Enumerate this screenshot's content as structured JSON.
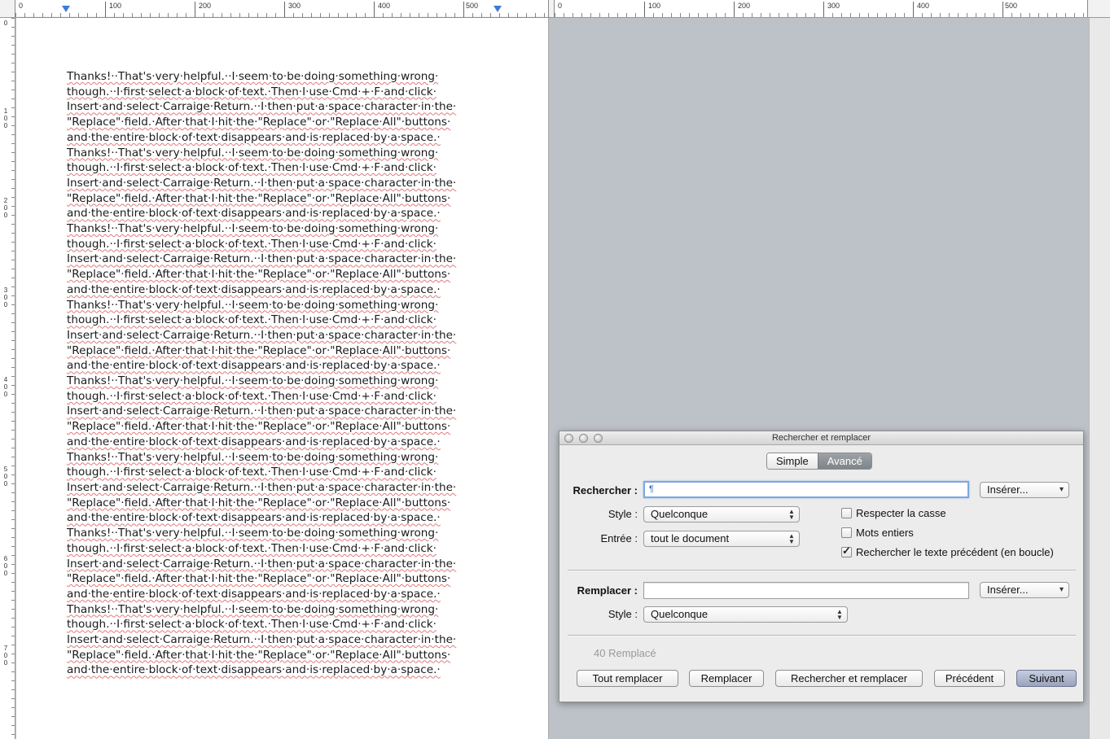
{
  "ruler": {
    "left_labels": [
      "0",
      "100",
      "200",
      "300",
      "400",
      "500"
    ],
    "right_labels": [
      "0",
      "100",
      "200",
      "300",
      "400",
      "500"
    ],
    "side_labels": [
      "0",
      "1 0 0",
      "2 0 0",
      "3 0 0",
      "4 0 0",
      "5 0 0",
      "6 0 0",
      "7 0 0"
    ]
  },
  "document": {
    "lines": [
      "Thanks!··That's·very·helpful.··I·seem·to·be·doing·something·wrong·",
      "though.··I·first·select·a·block·of·text.·Then·I·use·Cmd·+·F·and·click·",
      "Insert·and·select·Carraige·Return.··I·then·put·a·space·character·in·the·",
      "\"Replace\"·field.·After·that·I·hit·the·\"Replace\"·or·\"Replace·All\"·buttons·",
      "and·the·entire·block·of·text·disappears·and·is·replaced·by·a·space.·",
      "Thanks!··That's·very·helpful.··I·seem·to·be·doing·something·wrong·",
      "though.··I·first·select·a·block·of·text.·Then·I·use·Cmd·+·F·and·click·",
      "Insert·and·select·Carraige·Return.··I·then·put·a·space·character·in·the·",
      "\"Replace\"·field.·After·that·I·hit·the·\"Replace\"·or·\"Replace·All\"·buttons·",
      "and·the·entire·block·of·text·disappears·and·is·replaced·by·a·space.·",
      "Thanks!··That's·very·helpful.··I·seem·to·be·doing·something·wrong·",
      "though.··I·first·select·a·block·of·text.·Then·I·use·Cmd·+·F·and·click·",
      "Insert·and·select·Carraige·Return.··I·then·put·a·space·character·in·the·",
      "\"Replace\"·field.·After·that·I·hit·the·\"Replace\"·or·\"Replace·All\"·buttons·",
      "and·the·entire·block·of·text·disappears·and·is·replaced·by·a·space.·",
      "Thanks!··That's·very·helpful.··I·seem·to·be·doing·something·wrong·",
      "though.··I·first·select·a·block·of·text.·Then·I·use·Cmd·+·F·and·click·",
      "Insert·and·select·Carraige·Return.··I·then·put·a·space·character·in·the·",
      "\"Replace\"·field.·After·that·I·hit·the·\"Replace\"·or·\"Replace·All\"·buttons·",
      "and·the·entire·block·of·text·disappears·and·is·replaced·by·a·space.·",
      "Thanks!··That's·very·helpful.··I·seem·to·be·doing·something·wrong·",
      "though.··I·first·select·a·block·of·text.·Then·I·use·Cmd·+·F·and·click·",
      "Insert·and·select·Carraige·Return.··I·then·put·a·space·character·in·the·",
      "\"Replace\"·field.·After·that·I·hit·the·\"Replace\"·or·\"Replace·All\"·buttons·",
      "and·the·entire·block·of·text·disappears·and·is·replaced·by·a·space.·",
      "Thanks!··That's·very·helpful.··I·seem·to·be·doing·something·wrong·",
      "though.··I·first·select·a·block·of·text.·Then·I·use·Cmd·+·F·and·click·",
      "Insert·and·select·Carraige·Return.··I·then·put·a·space·character·in·the·",
      "\"Replace\"·field.·After·that·I·hit·the·\"Replace\"·or·\"Replace·All\"·buttons·",
      "and·the·entire·block·of·text·disappears·and·is·replaced·by·a·space.·",
      "Thanks!··That's·very·helpful.··I·seem·to·be·doing·something·wrong·",
      "though.··I·first·select·a·block·of·text.·Then·I·use·Cmd·+·F·and·click·",
      "Insert·and·select·Carraige·Return.··I·then·put·a·space·character·in·the·",
      "\"Replace\"·field.·After·that·I·hit·the·\"Replace\"·or·\"Replace·All\"·buttons·",
      "and·the·entire·block·of·text·disappears·and·is·replaced·by·a·space.·",
      "Thanks!··That's·very·helpful.··I·seem·to·be·doing·something·wrong·",
      "though.··I·first·select·a·block·of·text.·Then·I·use·Cmd·+·F·and·click·",
      "Insert·and·select·Carraige·Return.··I·then·put·a·space·character·in·the·",
      "\"Replace\"·field.·After·that·I·hit·the·\"Replace\"·or·\"Replace·All\"·buttons·",
      "and·the·entire·block·of·text·disappears·and·is·replaced·by·a·space.·"
    ]
  },
  "dialog": {
    "title": "Rechercher et remplacer",
    "tabs": {
      "simple": "Simple",
      "advanced": "Avancé"
    },
    "find": {
      "label": "Rechercher :",
      "value": "¶",
      "insert_label": "Insérer...",
      "style_label": "Style :",
      "style_value": "Quelconque",
      "scope_label": "Entrée :",
      "scope_value": "tout le document"
    },
    "options": {
      "match_case": {
        "label": "Respecter la casse",
        "checked": false
      },
      "whole_words": {
        "label": "Mots entiers",
        "checked": false
      },
      "wrap_around": {
        "label": "Rechercher le texte précédent (en boucle)",
        "checked": true
      }
    },
    "replace": {
      "label": "Remplacer :",
      "value": "",
      "insert_label": "Insérer...",
      "style_label": "Style :",
      "style_value": "Quelconque"
    },
    "status": "40 Remplacé",
    "buttons": {
      "replace_all": "Tout remplacer",
      "replace": "Remplacer",
      "find_replace": "Rechercher et remplacer",
      "previous": "Précédent",
      "next": "Suivant"
    }
  }
}
